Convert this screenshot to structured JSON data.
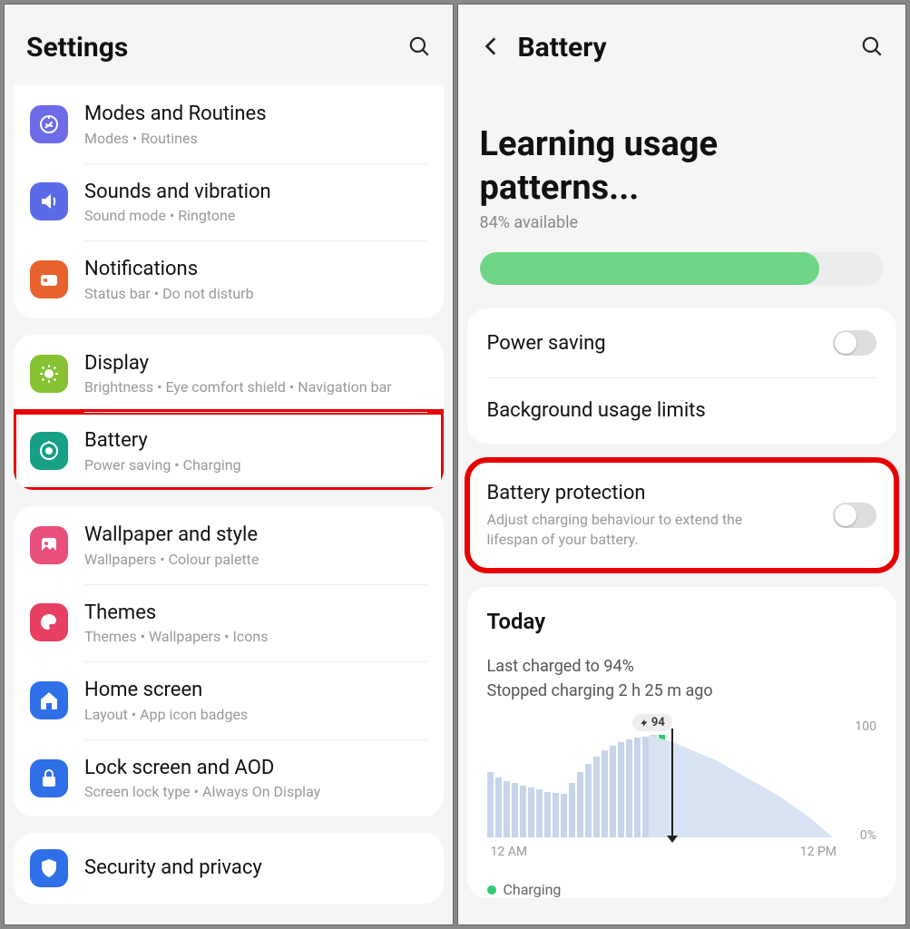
{
  "left": {
    "title": "Settings",
    "groups": [
      {
        "items": [
          {
            "key": "modes",
            "title": "Modes and Routines",
            "sub": "Modes  •  Routines",
            "icon": "modes",
            "bg": "#6e6be8",
            "fg": "#fff"
          },
          {
            "key": "sounds",
            "title": "Sounds and vibration",
            "sub": "Sound mode  •  Ringtone",
            "icon": "sound",
            "bg": "#5b6be8",
            "fg": "#fff"
          },
          {
            "key": "notifications",
            "title": "Notifications",
            "sub": "Status bar  •  Do not disturb",
            "icon": "notif",
            "bg": "#e8622d",
            "fg": "#fff"
          }
        ]
      },
      {
        "items": [
          {
            "key": "display",
            "title": "Display",
            "sub": "Brightness  •  Eye comfort shield  •  Navigation bar",
            "icon": "display",
            "bg": "#86c232",
            "fg": "#fff"
          },
          {
            "key": "battery",
            "title": "Battery",
            "sub": "Power saving  •  Charging",
            "icon": "battery",
            "bg": "#16a085",
            "fg": "#fff",
            "highlight": true
          }
        ]
      },
      {
        "items": [
          {
            "key": "wallpaper",
            "title": "Wallpaper and style",
            "sub": "Wallpapers  •  Colour palette",
            "icon": "wallpaper",
            "bg": "#e84f7a",
            "fg": "#fff"
          },
          {
            "key": "themes",
            "title": "Themes",
            "sub": "Themes  •  Wallpapers  •  Icons",
            "icon": "themes",
            "bg": "#e83f62",
            "fg": "#fff"
          },
          {
            "key": "home",
            "title": "Home screen",
            "sub": "Layout  •  App icon badges",
            "icon": "home",
            "bg": "#2f6fe8",
            "fg": "#fff"
          },
          {
            "key": "lock",
            "title": "Lock screen and AOD",
            "sub": "Screen lock type  •  Always On Display",
            "icon": "lock",
            "bg": "#2f6fe8",
            "fg": "#fff"
          }
        ]
      },
      {
        "items": [
          {
            "key": "security",
            "title": "Security and privacy",
            "sub": "",
            "icon": "shield",
            "bg": "#2f6fe8",
            "fg": "#fff"
          }
        ]
      }
    ]
  },
  "right": {
    "title": "Battery",
    "headline": "Learning usage patterns...",
    "available_text": "84% available",
    "progress_pct": 84,
    "rows": [
      {
        "key": "power_saving",
        "title": "Power saving",
        "toggle": true
      },
      {
        "key": "bg_limits",
        "title": "Background usage limits"
      },
      {
        "key": "protection",
        "title": "Battery protection",
        "sub": "Adjust charging behaviour to extend the lifespan of your battery.",
        "toggle": true,
        "highlight": true
      }
    ],
    "today": {
      "heading": "Today",
      "line1": "Last charged to 94%",
      "line2": "Stopped charging 2 h 25 m ago",
      "badge": "94",
      "x_left": "12 AM",
      "x_right": "12 PM",
      "y_top": "100",
      "y_bottom": "0%",
      "legend": "Charging"
    }
  },
  "chart_data": {
    "type": "bar",
    "title": "Today battery level",
    "xlabel": "",
    "ylabel": "%",
    "ylim": [
      0,
      100
    ],
    "x_ticks": [
      "12 AM",
      "12 PM"
    ],
    "now_index": 21,
    "badge_value": 94,
    "values": [
      60,
      55,
      52,
      50,
      48,
      46,
      44,
      42,
      41,
      40,
      50,
      60,
      68,
      74,
      80,
      84,
      88,
      90,
      92,
      93,
      94,
      94
    ],
    "forecast_start_index": 21,
    "forecast_values": [
      94,
      92,
      90,
      88,
      85,
      82,
      79,
      76,
      73,
      70,
      66,
      62,
      58,
      54,
      50,
      46,
      42,
      38,
      33,
      28,
      23,
      18,
      12,
      6,
      0
    ]
  }
}
